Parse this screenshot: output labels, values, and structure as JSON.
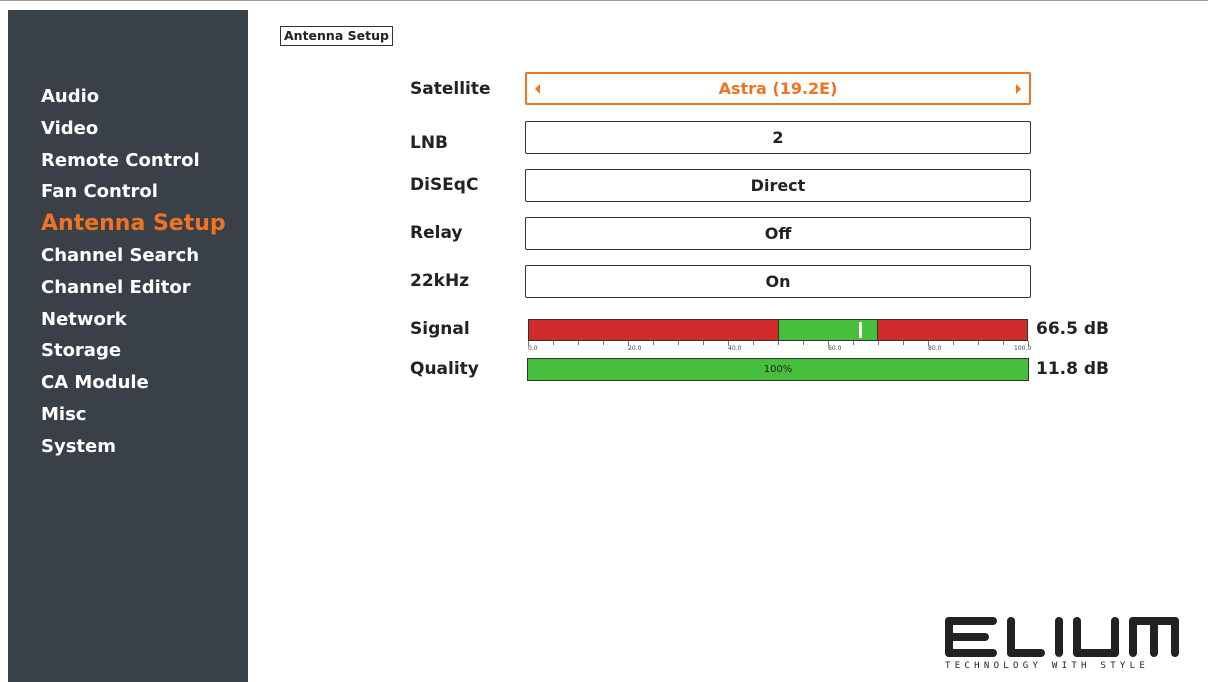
{
  "page_title": "Antenna Setup",
  "sidebar": {
    "items": [
      {
        "label": "Audio",
        "active": false
      },
      {
        "label": "Video",
        "active": false
      },
      {
        "label": "Remote Control",
        "active": false
      },
      {
        "label": "Fan Control",
        "active": false
      },
      {
        "label": "Antenna Setup",
        "active": true
      },
      {
        "label": "Channel Search",
        "active": false
      },
      {
        "label": "Channel Editor",
        "active": false
      },
      {
        "label": "Network",
        "active": false
      },
      {
        "label": "Storage",
        "active": false
      },
      {
        "label": "CA Module",
        "active": false
      },
      {
        "label": "Misc",
        "active": false
      },
      {
        "label": "System",
        "active": false
      }
    ]
  },
  "settings": {
    "satellite": {
      "label": "Satellite",
      "value": "Astra (19.2E)"
    },
    "lnb": {
      "label": "LNB",
      "value": "2"
    },
    "diseqc": {
      "label": "DiSEqC",
      "value": "Direct"
    },
    "relay": {
      "label": "Relay",
      "value": "Off"
    },
    "tone_22khz": {
      "label": "22kHz",
      "value": "On"
    }
  },
  "signal": {
    "label": "Signal",
    "readout": "66.5 dB",
    "level": 66.5,
    "green_range": [
      50,
      70
    ],
    "scale_labels": [
      "0.0",
      "20.0",
      "40.0",
      "60.0",
      "80.0",
      "100.0"
    ]
  },
  "quality": {
    "label": "Quality",
    "readout": "11.8 dB",
    "percent_text": "100%",
    "percent": 100
  },
  "brand": {
    "logo_text": "ELIUM",
    "tagline": "TECHNOLOGY WITH STYLE"
  },
  "colors": {
    "accent": "#ee7424",
    "sidebar_bg": "#3a4047",
    "signal_red": "#d12c2c",
    "signal_green": "#46bf3d"
  }
}
